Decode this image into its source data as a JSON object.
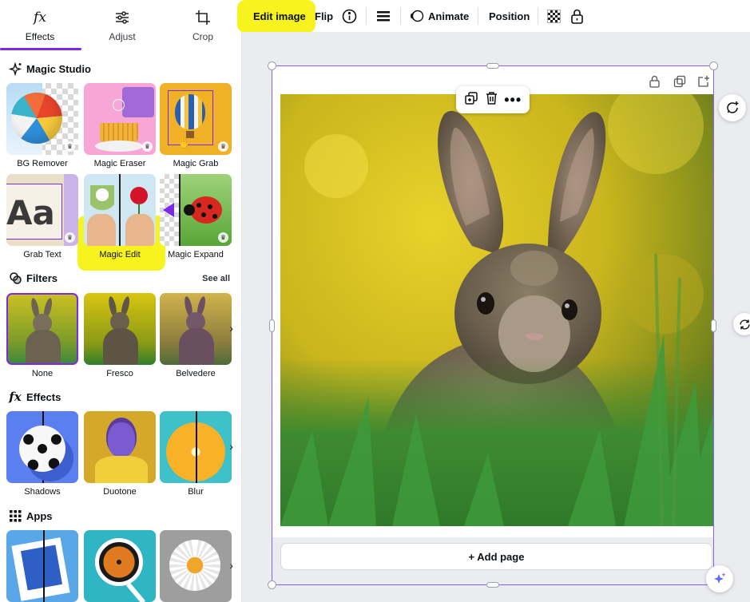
{
  "panel": {
    "tabs": [
      {
        "label": "Effects",
        "icon": "fx-icon",
        "active": true
      },
      {
        "label": "Adjust",
        "icon": "sliders-icon"
      },
      {
        "label": "Crop",
        "icon": "crop-icon"
      }
    ],
    "magic_studio": {
      "title": "Magic Studio",
      "tools": [
        {
          "label": "BG Remover",
          "premium": true
        },
        {
          "label": "Magic Eraser",
          "premium": true
        },
        {
          "label": "Magic Grab",
          "premium": true
        },
        {
          "label": "Grab Text",
          "premium": true
        },
        {
          "label": "Magic Edit",
          "highlighted": true
        },
        {
          "label": "Magic Expand",
          "premium": true
        }
      ],
      "grab_text_sample": "Aa"
    },
    "filters": {
      "title": "Filters",
      "see_all": "See all",
      "items": [
        {
          "label": "None",
          "selected": true
        },
        {
          "label": "Fresco"
        },
        {
          "label": "Belvedere"
        }
      ]
    },
    "effects": {
      "title": "Effects",
      "items": [
        {
          "label": "Shadows"
        },
        {
          "label": "Duotone"
        },
        {
          "label": "Blur"
        }
      ]
    },
    "apps": {
      "title": "Apps"
    }
  },
  "toolbar": {
    "edit_image": "Edit image",
    "flip": "Flip",
    "animate": "Animate",
    "position": "Position"
  },
  "canvas": {
    "add_page": "+ Add page"
  },
  "colors": {
    "accent": "#7d2ae8",
    "highlight": "#f7f31e",
    "selection": "#8b5cf6"
  }
}
